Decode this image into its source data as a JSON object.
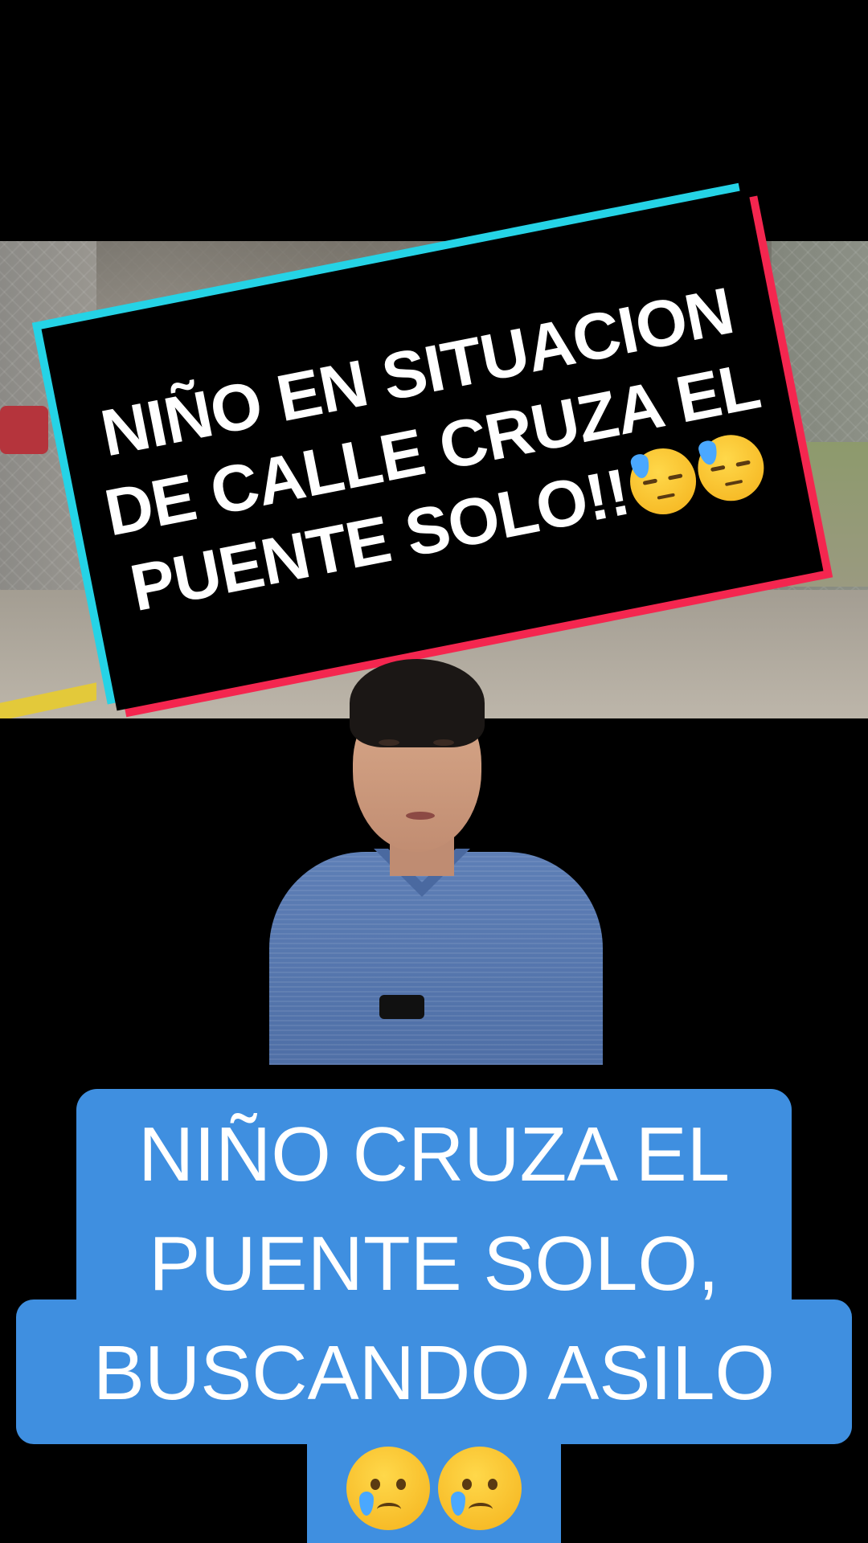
{
  "banner": {
    "line1": "NIÑO EN SITUACION",
    "line2": "DE CALLE CRUZA EL",
    "line3": "PUENTE SOLO!!",
    "emojis": [
      "downcast-face-with-sweat",
      "downcast-face-with-sweat"
    ],
    "colors": {
      "background": "#000000",
      "accent_left": "#25d3e6",
      "accent_right": "#f4264f",
      "text": "#ffffff"
    }
  },
  "caption": {
    "line1": "NIÑO CRUZA EL",
    "line2": "PUENTE SOLO,",
    "line3": "BUSCANDO ASILO",
    "emojis": [
      "crying-face",
      "crying-face"
    ],
    "colors": {
      "background": "#3f8fe0",
      "text": "#ffffff"
    }
  }
}
